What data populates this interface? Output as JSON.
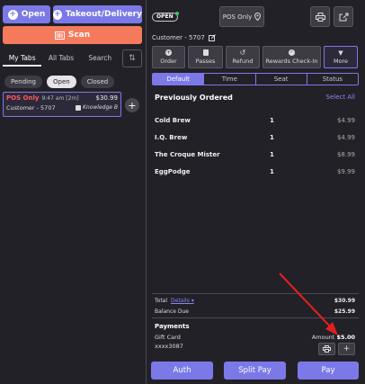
{
  "left": {
    "open_label": "Open",
    "takeout_label": "Takeout/Delivery",
    "scan_label": "Scan",
    "tabs": [
      {
        "label": "My Tabs",
        "active": true
      },
      {
        "label": "All Tabs",
        "active": false
      },
      {
        "label": "Search",
        "active": false
      }
    ],
    "filters": [
      {
        "label": "Pending",
        "active": false
      },
      {
        "label": "Open",
        "active": true
      },
      {
        "label": "Closed",
        "active": false
      }
    ],
    "tab_card": {
      "pos_label": "POS Only",
      "time": "9:47 am [2m]",
      "amount": "$30.99",
      "customer": "Customer - 5707",
      "employee": "Knowledge B"
    }
  },
  "right": {
    "status": "OPEN",
    "pos_only_label": "POS Only",
    "customer": "Customer - 5707",
    "actions": [
      {
        "label": "Order",
        "icon": "plus-circle-icon"
      },
      {
        "label": "Passes",
        "icon": "clipboard-icon"
      },
      {
        "label": "Refund",
        "icon": "undo-icon"
      },
      {
        "label": "Rewards Check-In",
        "icon": "check-circle-icon"
      },
      {
        "label": "More",
        "icon": "caret-down-icon"
      }
    ],
    "segments": [
      {
        "label": "Default",
        "active": true
      },
      {
        "label": "Time",
        "active": false
      },
      {
        "label": "Seat",
        "active": false
      },
      {
        "label": "Status",
        "active": false
      }
    ],
    "previously_ordered_title": "Previously Ordered",
    "select_all_label": "Select All",
    "items": [
      {
        "name": "Cold Brew",
        "qty": "1",
        "price": "$4.99"
      },
      {
        "name": "I.Q. Brew",
        "qty": "1",
        "price": "$4.99"
      },
      {
        "name": "The Croque Mister",
        "qty": "1",
        "price": "$8.99"
      },
      {
        "name": "EggPodge",
        "qty": "1",
        "price": "$9.99"
      }
    ],
    "total_label": "Total",
    "details_label": "Details",
    "total_value": "$30.99",
    "balance_label": "Balance Due",
    "balance_value": "$25.99",
    "payments_title": "Payments",
    "payment_method": "Gift Card",
    "payment_account": "xxxx3087",
    "amount_label": "Amount",
    "amount_value": "$5.00",
    "auth_label": "Auth",
    "split_label": "Split Pay",
    "pay_label": "Pay"
  },
  "colors": {
    "accent": "#7b79e8",
    "orange": "#f57a5c",
    "annotation_arrow": "#e02020",
    "pos_red": "#ff5a5a"
  }
}
